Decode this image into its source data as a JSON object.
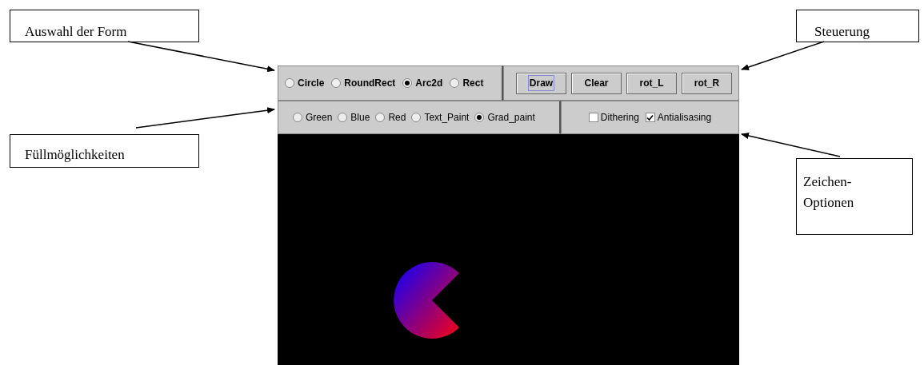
{
  "callouts": [
    {
      "text": "Auswahl der Form"
    },
    {
      "text": "Steuerung"
    },
    {
      "text": "Füllmöglichkeiten"
    },
    {
      "text": "Zeichen-\nOptionen"
    }
  ],
  "shape_options": [
    {
      "label": "Circle",
      "selected": false
    },
    {
      "label": "RoundRect",
      "selected": false
    },
    {
      "label": "Arc2d",
      "selected": true
    },
    {
      "label": "Rect",
      "selected": false
    }
  ],
  "buttons": [
    {
      "label": "Draw",
      "focused": true
    },
    {
      "label": "Clear",
      "focused": false
    },
    {
      "label": "rot_L",
      "focused": false
    },
    {
      "label": "rot_R",
      "focused": false
    }
  ],
  "fill_options": [
    {
      "label": "Green",
      "selected": false
    },
    {
      "label": "Blue",
      "selected": false
    },
    {
      "label": "Red",
      "selected": false
    },
    {
      "label": "Text_Paint",
      "selected": false
    },
    {
      "label": "Grad_paint",
      "selected": true
    }
  ],
  "draw_options": [
    {
      "label": "Dithering",
      "checked": false
    },
    {
      "label": "Antialisasing",
      "checked": true
    }
  ]
}
